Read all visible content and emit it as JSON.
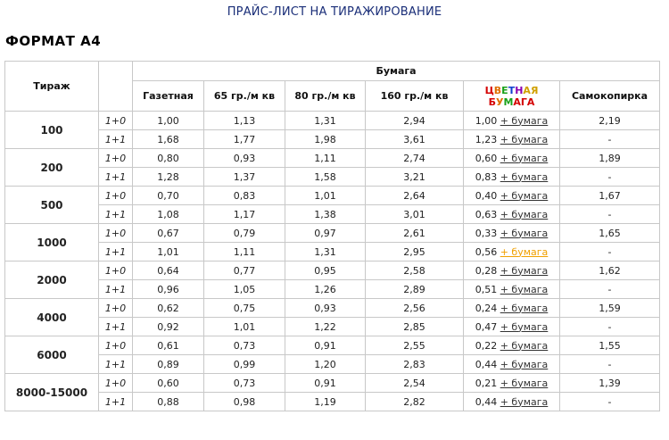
{
  "page_title": "ПРАЙС-ЛИСТ НА ТИРАЖИРОВАНИЕ",
  "format_heading": "ФОРМАТ А4",
  "headers": {
    "tirazh": "Тираж",
    "paper_group": "Бумага",
    "columns": [
      "Газетная",
      "65 гр./м кв",
      "80 гр./м кв",
      "160 гр./м кв",
      "ЦВЕТНАЯ БУМАГА",
      "Самокопирка"
    ],
    "color_word1": [
      {
        "ch": "Ц",
        "color": "#d40000"
      },
      {
        "ch": "В",
        "color": "#e07000"
      },
      {
        "ch": "Е",
        "color": "#18a018"
      },
      {
        "ch": "Т",
        "color": "#1040d0"
      },
      {
        "ch": "Н",
        "color": "#8a00b0"
      },
      {
        "ch": "А",
        "color": "#d0a000"
      },
      {
        "ch": "Я",
        "color": "#d0a000"
      }
    ],
    "color_word2": [
      {
        "ch": "Б",
        "color": "#d40000"
      },
      {
        "ch": "У",
        "color": "#e07000"
      },
      {
        "ch": "М",
        "color": "#18a018"
      },
      {
        "ch": "А",
        "color": "#d40000"
      },
      {
        "ch": "Г",
        "color": "#d40000"
      },
      {
        "ch": "А",
        "color": "#d40000"
      }
    ]
  },
  "link_text": "+ бумага",
  "rows": [
    {
      "tirazh": "100",
      "lines": [
        {
          "ver": "1+0",
          "values": [
            "1,00",
            "1,13",
            "1,31",
            "2,94"
          ],
          "color": "1,00",
          "samokopirka": "2,19",
          "link_active": false
        },
        {
          "ver": "1+1",
          "values": [
            "1,68",
            "1,77",
            "1,98",
            "3,61"
          ],
          "color": "1,23",
          "samokopirka": "-",
          "link_active": false
        }
      ]
    },
    {
      "tirazh": "200",
      "lines": [
        {
          "ver": "1+0",
          "values": [
            "0,80",
            "0,93",
            "1,11",
            "2,74"
          ],
          "color": "0,60",
          "samokopirka": "1,89",
          "link_active": false
        },
        {
          "ver": "1+1",
          "values": [
            "1,28",
            "1,37",
            "1,58",
            "3,21"
          ],
          "color": "0,83",
          "samokopirka": "-",
          "link_active": false
        }
      ]
    },
    {
      "tirazh": "500",
      "lines": [
        {
          "ver": "1+0",
          "values": [
            "0,70",
            "0,83",
            "1,01",
            "2,64"
          ],
          "color": "0,40",
          "samokopirka": "1,67",
          "link_active": false
        },
        {
          "ver": "1+1",
          "values": [
            "1,08",
            "1,17",
            "1,38",
            "3,01"
          ],
          "color": "0,63",
          "samokopirka": "-",
          "link_active": false
        }
      ]
    },
    {
      "tirazh": "1000",
      "lines": [
        {
          "ver": "1+0",
          "values": [
            "0,67",
            "0,79",
            "0,97",
            "2,61"
          ],
          "color": "0,33",
          "samokopirka": "1,65",
          "link_active": false
        },
        {
          "ver": "1+1",
          "values": [
            "1,01",
            "1,11",
            "1,31",
            "2,95"
          ],
          "color": "0,56",
          "samokopirka": "-",
          "link_active": true
        }
      ]
    },
    {
      "tirazh": "2000",
      "lines": [
        {
          "ver": "1+0",
          "values": [
            "0,64",
            "0,77",
            "0,95",
            "2,58"
          ],
          "color": "0,28",
          "samokopirka": "1,62",
          "link_active": false
        },
        {
          "ver": "1+1",
          "values": [
            "0,96",
            "1,05",
            "1,26",
            "2,89"
          ],
          "color": "0,51",
          "samokopirka": "-",
          "link_active": false
        }
      ]
    },
    {
      "tirazh": "4000",
      "lines": [
        {
          "ver": "1+0",
          "values": [
            "0,62",
            "0,75",
            "0,93",
            "2,56"
          ],
          "color": "0,24",
          "samokopirka": "1,59",
          "link_active": false
        },
        {
          "ver": "1+1",
          "values": [
            "0,92",
            "1,01",
            "1,22",
            "2,85"
          ],
          "color": "0,47",
          "samokopirka": "-",
          "link_active": false
        }
      ]
    },
    {
      "tirazh": "6000",
      "lines": [
        {
          "ver": "1+0",
          "values": [
            "0,61",
            "0,73",
            "0,91",
            "2,55"
          ],
          "color": "0,22",
          "samokopirka": "1,55",
          "link_active": false
        },
        {
          "ver": "1+1",
          "values": [
            "0,89",
            "0,99",
            "1,20",
            "2,83"
          ],
          "color": "0,44",
          "samokopirka": "-",
          "link_active": false
        }
      ]
    },
    {
      "tirazh": "8000-15000",
      "lines": [
        {
          "ver": "1+0",
          "values": [
            "0,60",
            "0,73",
            "0,91",
            "2,54"
          ],
          "color": "0,21",
          "samokopirka": "1,39",
          "link_active": false
        },
        {
          "ver": "1+1",
          "values": [
            "0,88",
            "0,98",
            "1,19",
            "2,82"
          ],
          "color": "0,44",
          "samokopirka": "-",
          "link_active": false
        }
      ]
    }
  ]
}
